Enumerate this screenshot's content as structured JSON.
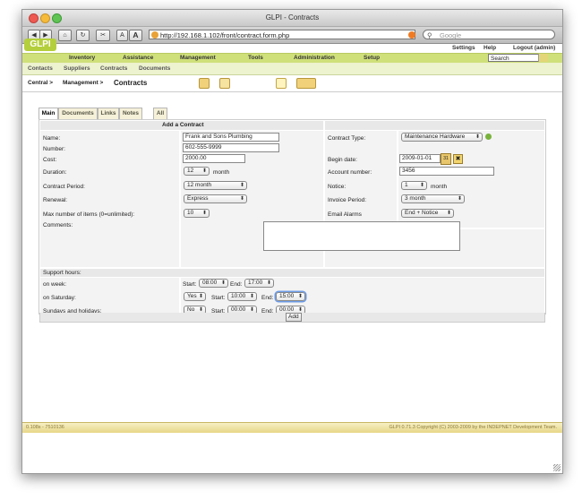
{
  "window": {
    "title": "GLPI - Contracts"
  },
  "browser": {
    "url": "http://192.168.1.102/front/contract.form.php",
    "search_placeholder": "Google",
    "font_small": "A",
    "font_large": "A"
  },
  "header": {
    "settings": "Settings",
    "help": "Help",
    "logout": "Logout (admin)",
    "logo": "GLPI",
    "search_value": "Search"
  },
  "menu": {
    "items": [
      "Inventory",
      "Assistance",
      "Management",
      "Tools",
      "Administration",
      "Setup"
    ]
  },
  "submenu": {
    "items": [
      "Contacts",
      "Suppliers",
      "Contracts",
      "Documents"
    ]
  },
  "breadcrumb": {
    "central": "Central >",
    "management": "Management >",
    "current": "Contracts"
  },
  "tabs": [
    "Main",
    "Documents",
    "Links",
    "Notes",
    "All"
  ],
  "form": {
    "title": "Add a Contract",
    "name_label": "Name:",
    "name_value": "Frank and Sons Plumbing",
    "number_label": "Number:",
    "number_value": "602-555-9999",
    "cost_label": "Cost:",
    "cost_value": "2000.00",
    "duration_label": "Duration:",
    "duration_value": "12",
    "duration_unit": "month",
    "period_label": "Contract Period:",
    "period_value": "12 month",
    "renewal_label": "Renewal:",
    "renewal_value": "Express",
    "maxitems_label": "Max number of items (0=unlimited):",
    "maxitems_value": "10",
    "comments_label": "Comments:",
    "type_label": "Contract Type:",
    "type_value": "Maintenance Hardware",
    "begin_label": "Begin date:",
    "begin_value": "2009-01-01",
    "account_label": "Account number:",
    "account_value": "3456",
    "notice_label": "Notice:",
    "notice_value": "1",
    "notice_unit": "month",
    "invoice_label": "Invoice Period:",
    "invoice_value": "3 month",
    "alarms_label": "Email Alarms",
    "alarms_value": "End + Notice",
    "support_label": "Support hours:",
    "week_label": "on week:",
    "week_start_label": "Start:",
    "week_start": "08:00",
    "week_end_label": "End:",
    "week_end": "17:00",
    "sat_label": "on Saturday:",
    "sat_enabled": "Yes",
    "sat_start_label": "Start:",
    "sat_start": "10:00",
    "sat_end_label": "End:",
    "sat_end": "15:00",
    "sun_label": "Sundays and holidays:",
    "sun_enabled": "No",
    "sun_start_label": "Start:",
    "sun_start": "00:00",
    "sun_end_label": "End:",
    "sun_end": "00:00",
    "add_button": "Add"
  },
  "footer": {
    "left": "0.108s - 7510136",
    "right": "GLPI 0.71.3 Copyright (C) 2003-2009 by the INDEPNET Development Team."
  },
  "colors": {
    "menu_green": "#cfe07a",
    "footer_yellow": "#e7d788"
  }
}
